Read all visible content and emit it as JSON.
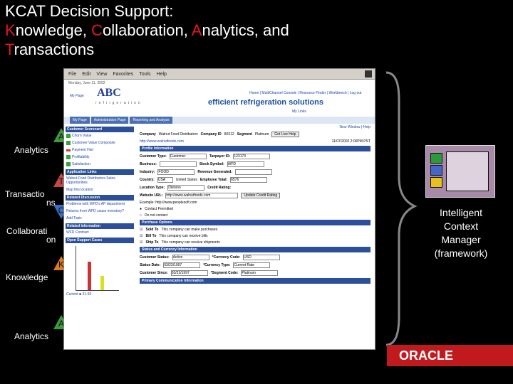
{
  "title": {
    "line1": "KCAT Decision Support:",
    "l2_k": "K",
    "l2_rest1": "nowledge, ",
    "l2_c": "C",
    "l2_rest2": "ollaboration, ",
    "l2_a": "A",
    "l2_rest3": "nalytics, and",
    "l3_t": "T",
    "l3_rest": "ransactions"
  },
  "side_labels": {
    "a1": "A",
    "analytics1": "Analytics",
    "t": "T",
    "transactions_a": "Transactio",
    "transactions_b": "ns",
    "c": "C",
    "collab_a": "Collaborati",
    "collab_b": "on",
    "k": "K",
    "knowledge": "Knowledge",
    "a2": "A",
    "analytics2": "Analytics",
    "t_top": "T"
  },
  "screenshot": {
    "menu": [
      "File",
      "Edit",
      "View",
      "Favorites",
      "Tools",
      "Help"
    ],
    "date": "Monday, June 11, 2002",
    "logo": "ABC",
    "logo_sub": "refrigeration",
    "tagline": "efficient refrigeration solutions",
    "top_links": "Home | MultiChannel Console | Resource Finder | Workbench | Log out",
    "my_links": "My Links",
    "tabs": [
      "My Page",
      "Administration Page",
      "Reporting and Analysis"
    ],
    "left": {
      "scorecard_hdr": "Customer Scorecard",
      "scorecard_items": [
        "Churn Value",
        "Customer Value Composite",
        "Payment Hist",
        "Profitability",
        "Satisfaction"
      ],
      "app_links_hdr": "Application Links",
      "app_links": [
        "Walnut Food Distributors Sales Opportunities",
        "Map this location"
      ],
      "discussion_hdr": "Related Discussion",
      "discussion_items": [
        "Problems with WFD's AP department",
        "Returns from WFD cause inventory?",
        "Add Topic"
      ],
      "info_hdr": "Related Information",
      "info_items": [
        "WFD Contract"
      ],
      "cases_hdr": "Open Support Cases",
      "legend": "Current ■ 31-60"
    },
    "right": {
      "new_window": "New Window | Help",
      "company_lbl": "Company",
      "company_val": "Walnut Food Distributors",
      "company_id_lbl": "Company ID",
      "company_id_val": "80212",
      "segment_lbl": "Segment",
      "segment_val": "Platinum",
      "website": "http://www.walnutfoods.com",
      "get_help": "Get Live Help",
      "timestamp": "11/07/2002 2:00PM PST",
      "profile_hdr": "Profile Information",
      "cust_type_lbl": "Customer Type:",
      "cust_type_val": "Customer",
      "taxpayer_lbl": "Taxpayer ID:",
      "taxpayer_val": "123173",
      "business_lbl": "Business:",
      "stock_lbl": "Stock Symbol:",
      "stock_val": "WFD",
      "industry_lbl": "Industry:",
      "industry_val": "FOOD",
      "revenue_lbl": "Revenue Generated:",
      "country_lbl": "Country:",
      "country_val": "USA",
      "country_txt": "United States",
      "emp_lbl": "Employee Total:",
      "emp_val": "6576",
      "loc_lbl": "Location Type:",
      "loc_val": "Division",
      "credit_lbl": "Credit Rating:",
      "web_lbl": "Website URL:",
      "web_val": "http://www.walnutfoods.com",
      "update_btn": "Update Credit Rating",
      "example": "Example: http://www.peoplesoft.com",
      "permit": "Contact Permitted",
      "no_contact": "Do not contact",
      "purchase_hdr": "Purchase Options",
      "sold_to": "Sold To",
      "sold_to_txt": "This company can make purchases",
      "bill_to": "Bill To",
      "bill_to_txt": "This company can receive bills",
      "ship_to": "Ship To",
      "ship_to_txt": "This company can receive shipments",
      "status_hdr": "Status and Currency Information",
      "cust_status_lbl": "Customer Status:",
      "cust_status_val": "Active",
      "currency_lbl": "*Currency Code:",
      "currency_val": "USD",
      "status_date_lbl": "Status Date:",
      "status_date_val": "03/23/1997",
      "ctype_lbl": "*Currency Type:",
      "ctype_val": "Current Rate",
      "since_lbl": "Customer Since:",
      "since_val": "03/23/1997",
      "seg_code_lbl": "*Segment Code:",
      "seg_code_val": "Platinum",
      "primary_hdr": "Primary Communication Information"
    }
  },
  "context": {
    "line1": "Intelligent",
    "line2": "Context",
    "line3": "Manager",
    "line4": "(framework)"
  },
  "brand": "ORACLE",
  "colors": {
    "accent": "#e0181c",
    "green": "#3d9a3d",
    "blue": "#3a6fc0",
    "orange": "#e07a1a",
    "red": "#c4484a"
  }
}
